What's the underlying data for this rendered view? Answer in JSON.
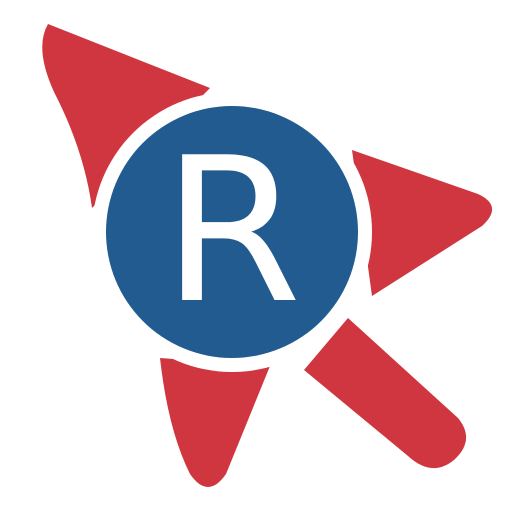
{
  "logo": {
    "letter": "R",
    "colors": {
      "arrow": "#D0363F",
      "circle": "#225B8F",
      "ring": "#FFFFFF",
      "letter": "#FFFFFF",
      "background": "#FFFFFF"
    },
    "icon": "cursor-arrow-icon"
  }
}
